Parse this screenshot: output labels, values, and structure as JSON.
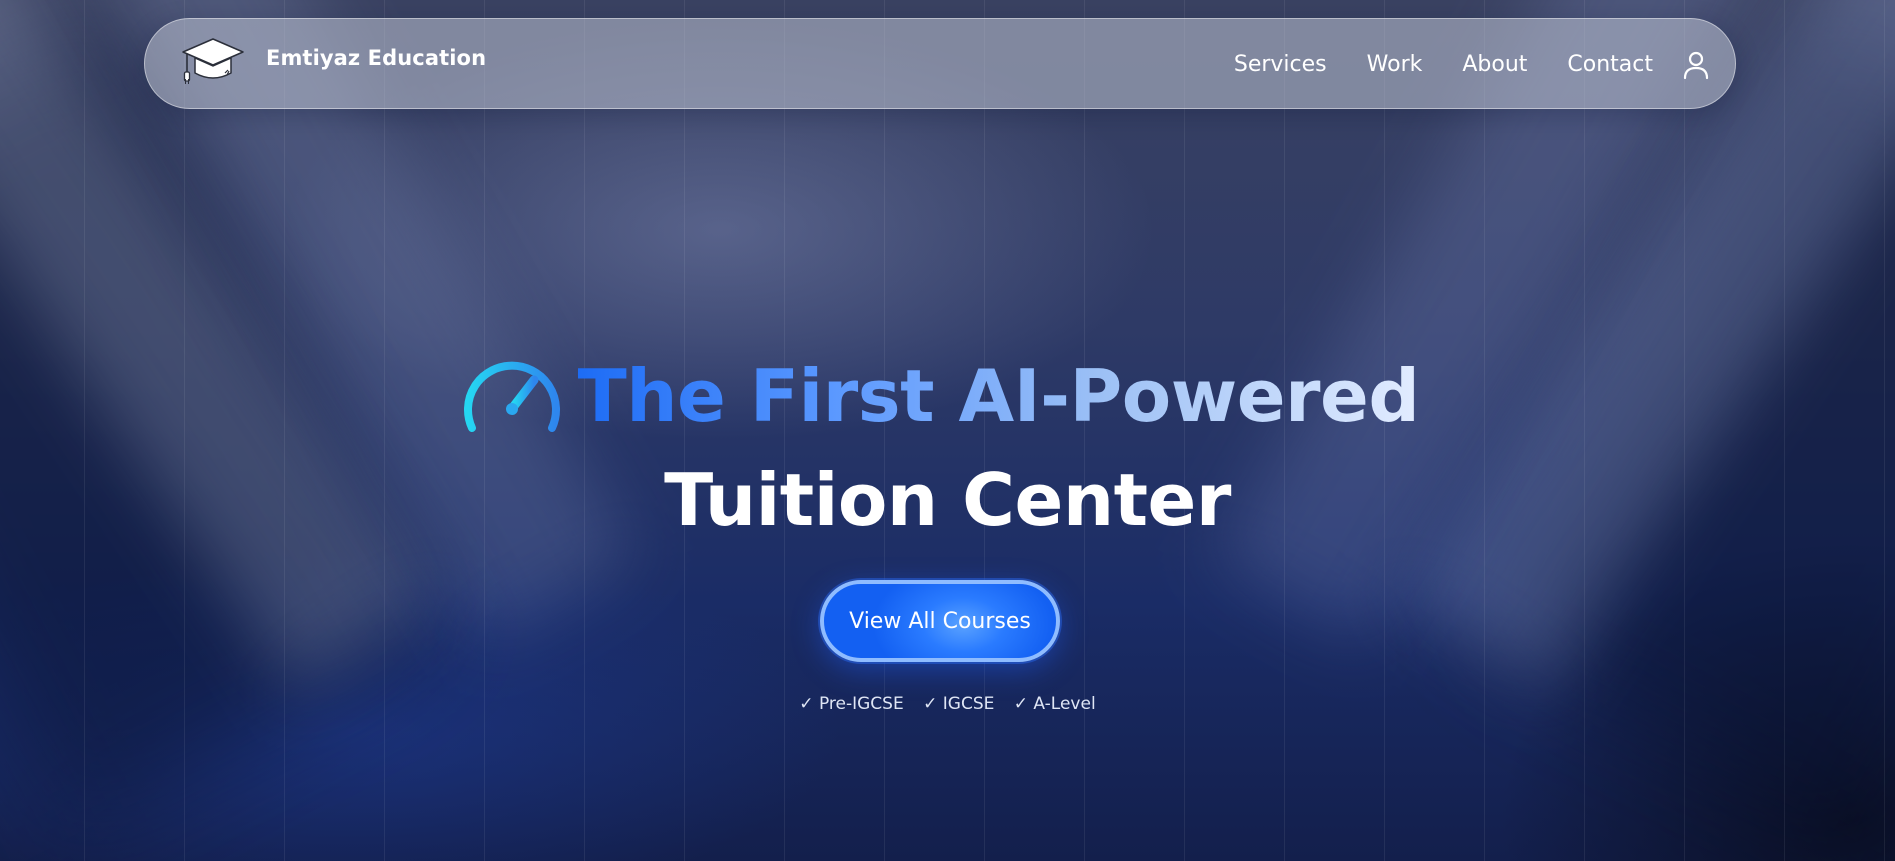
{
  "brand": {
    "name": "Emtiyaz Education",
    "logo_icon": "graduation-cap-icon"
  },
  "nav": {
    "items": [
      {
        "label": "Services"
      },
      {
        "label": "Work"
      },
      {
        "label": "About"
      },
      {
        "label": "Contact"
      }
    ],
    "user_icon": "user-icon"
  },
  "hero": {
    "title_line1": "The First AI-Powered",
    "title_line2": "Tuition Center",
    "title_icon": "speedometer-icon",
    "cta_label": "View All Courses",
    "tags": [
      "✓ Pre-IGCSE",
      "✓ IGCSE",
      "✓ A-Level"
    ]
  },
  "colors": {
    "accent": "#1d6cf5",
    "button": "#2a7bff",
    "background_top": "#3a4262",
    "background_bottom": "#131f4c"
  }
}
